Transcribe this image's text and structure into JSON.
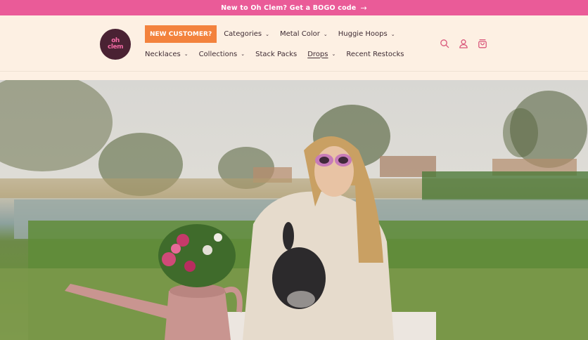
{
  "announcement": {
    "text": "New to Oh Clem? Get a BOGO code",
    "arrow": "→"
  },
  "logo": {
    "line1": "oh",
    "line2": "clem"
  },
  "nav": {
    "promo_label": "NEW CUSTOMER?",
    "row1": [
      {
        "label": "Categories",
        "dropdown": true
      },
      {
        "label": "Metal Color",
        "dropdown": true
      },
      {
        "label": "Huggie Hoops",
        "dropdown": true
      }
    ],
    "row2": [
      {
        "label": "Necklaces",
        "dropdown": true
      },
      {
        "label": "Collections",
        "dropdown": true
      },
      {
        "label": "Stack Packs",
        "dropdown": false
      },
      {
        "label": "Drops",
        "dropdown": true,
        "active": true
      },
      {
        "label": "Recent Restocks",
        "dropdown": false
      }
    ]
  },
  "icons": [
    "search-icon",
    "account-icon",
    "cart-icon"
  ],
  "colors": {
    "announcement_bg": "#ea5b98",
    "header_bg": "#fdf0e3",
    "promo_bg": "#f3823d",
    "icon": "#d9577a"
  }
}
